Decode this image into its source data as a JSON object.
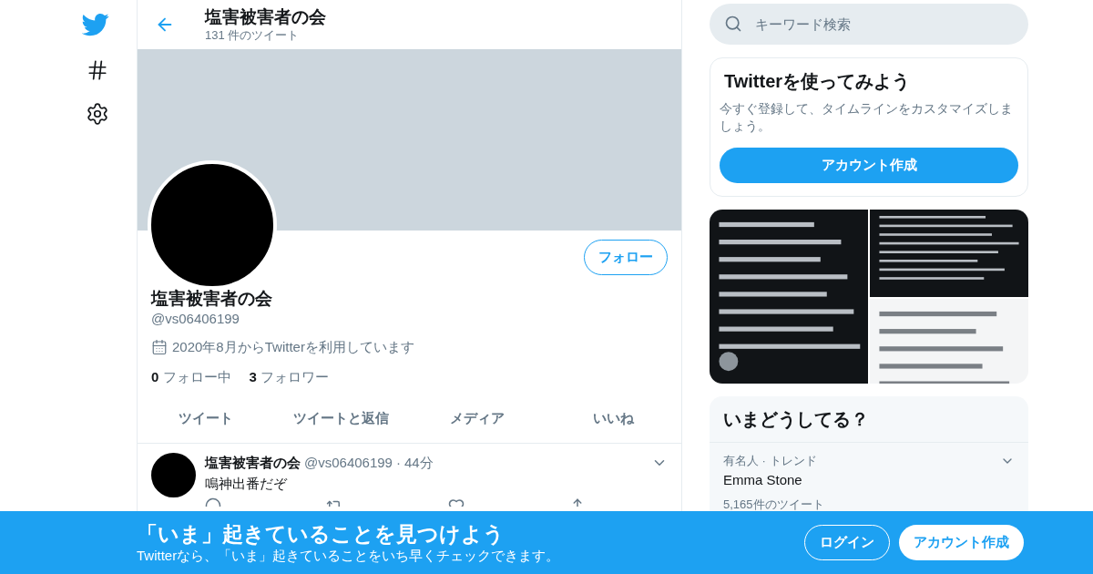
{
  "header": {
    "title": "塩害被害者の会",
    "subtitle": "131 件のツイート"
  },
  "profile": {
    "name": "塩害被害者の会",
    "handle": "@vs06406199",
    "joined": "2020年8月からTwitterを利用しています",
    "follow_button": "フォロー",
    "following_count": "0",
    "following_label": "フォロー中",
    "followers_count": "3",
    "followers_label": "フォロワー"
  },
  "tabs": [
    {
      "label": "ツイート",
      "selected": false
    },
    {
      "label": "ツイートと返信",
      "selected": false
    },
    {
      "label": "メディア",
      "selected": false
    },
    {
      "label": "いいね",
      "selected": false
    }
  ],
  "tweet": {
    "name": "塩害被害者の会",
    "handle": "@vs06406199",
    "separator": "·",
    "time": "44分",
    "text": "鳴神出番だぞ"
  },
  "search": {
    "placeholder": "キーワード検索"
  },
  "signup_card": {
    "title": "Twitterを使ってみよう",
    "text": "今すぐ登録して、タイムラインをカスタマイズしましょう。",
    "button": "アカウント作成"
  },
  "trends": {
    "title": "いまどうしてる？",
    "items": [
      {
        "context": "有名人 · トレンド",
        "name": "Emma Stone",
        "count": "5,165件のツイート"
      }
    ]
  },
  "banner": {
    "title": "「いま」起きていることを見つけよう",
    "subtitle": "Twitterなら、「いま」起きていることをいち早くチェックできます。",
    "login": "ログイン",
    "signup": "アカウント作成"
  }
}
